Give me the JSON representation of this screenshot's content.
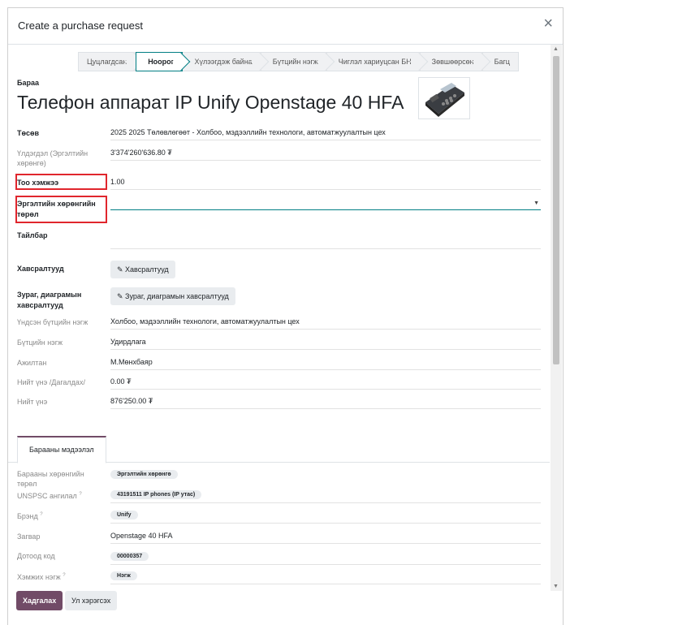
{
  "dialog": {
    "title": "Create a purchase request",
    "close_label": "×"
  },
  "stages": [
    "Цуцлагдсан",
    "Ноорог",
    "Хүлээгдэж байна",
    "Бүтцийн нэгж",
    "Чиглэл хариуцсан БН",
    "Зөвшөөрсөн",
    "Багц"
  ],
  "active_stage": "Ноорог",
  "product": {
    "label": "Бараа",
    "name": "Телефон аппарат IP Unify Openstage 40 HFA"
  },
  "fields": {
    "budget": {
      "label": "Төсөв",
      "value": "2025 2025 Төлөвлөгөөт - Холбоо, мэдээллийн технологи, автоматжуулалтын цех"
    },
    "balance": {
      "label": "Үлдэгдэл (Эргэлтийн хөрөнгө)",
      "value": "3'374'260'636.80 ₮"
    },
    "quantity": {
      "label": "Тоо хэмжээ",
      "value": "1.00"
    },
    "asset_type": {
      "label": "Эргэлтийн хөрөнгийн төрөл",
      "value": ""
    },
    "description": {
      "label": "Тайлбар",
      "value": ""
    },
    "attachments": {
      "label": "Хавсралтууд",
      "button": "Хавсралтууд"
    },
    "diagrams": {
      "label": "Зураг, диаграмын хавсралтууд",
      "button": "Зураг, диаграмын хавсралтууд"
    },
    "main_unit": {
      "label": "Үндсэн бүтцийн нэгж",
      "value": "Холбоо, мэдээллийн технологи, автоматжуулалтын цех"
    },
    "unit": {
      "label": "Бүтцийн нэгж",
      "value": "Удирдлага"
    },
    "employee": {
      "label": "Ажилтан",
      "value": "М.Мөнхбаяр"
    },
    "total_tax": {
      "label": "Нийт үнэ /Дагалдах/",
      "value": "0.00 ₮"
    },
    "total": {
      "label": "Нийт үнэ",
      "value": "876'250.00 ₮"
    }
  },
  "tab": {
    "label": "Барааны мэдээлэл"
  },
  "details": {
    "product_type": {
      "label": "Барааны хөрөнгийн төрөл",
      "value": "Эргэлтийн хөрөнгө"
    },
    "unspsc": {
      "label": "UNSPSC ангилал",
      "value": "43191511 IP phones (IP утас)"
    },
    "brand": {
      "label": "Брэнд",
      "value": "Unify"
    },
    "model": {
      "label": "Загвар",
      "value": "Openstage 40 HFA"
    },
    "internal_code": {
      "label": "Дотоод код",
      "value": "00000357"
    },
    "uom": {
      "label": "Хэмжих нэгж",
      "value": "Нэгж"
    },
    "help_mark": "?"
  },
  "footer": {
    "save": "Хадгалах",
    "discard": "Ул хэрэгсэх"
  },
  "colors": {
    "primary": "#714b67",
    "accent": "#017e84",
    "highlight": "#e0262d"
  }
}
